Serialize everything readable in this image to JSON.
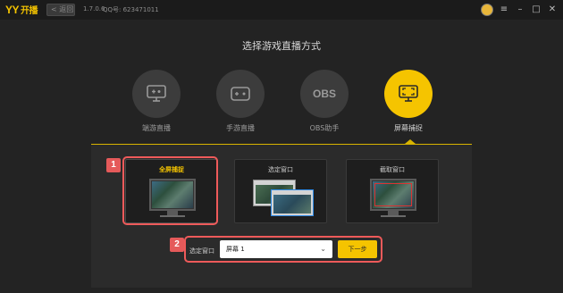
{
  "titlebar": {
    "logo": "YY",
    "logo_cn": "开播",
    "back_label": "< 返回",
    "version": "1.7.0.6",
    "qq": "QQ号: 623471011",
    "icons": [
      "avatar",
      "menu-icon",
      "minimize-icon",
      "maximize-icon",
      "close-icon"
    ]
  },
  "heading": "选择游戏直播方式",
  "modes": [
    {
      "label": "端游直播",
      "icon": "pc-gamepad-icon"
    },
    {
      "label": "手游直播",
      "icon": "mobile-gamepad-icon"
    },
    {
      "label": "OBS助手",
      "icon": "obs-icon",
      "text": "OBS"
    },
    {
      "label": "屏幕捕捉",
      "icon": "screen-capture-icon",
      "active": true
    }
  ],
  "capture_options": [
    {
      "title": "全屏捕捉",
      "selected": true
    },
    {
      "title": "选定窗口"
    },
    {
      "title": "截取窗口"
    }
  ],
  "form": {
    "window_label": "选定窗口",
    "select_value": "屏幕 1",
    "next_label": "下一步"
  },
  "annotations": {
    "badge1": "1",
    "badge2": "2"
  },
  "colors": {
    "accent": "#f5c400",
    "annotation": "#e55a5a",
    "background": "#232323"
  }
}
